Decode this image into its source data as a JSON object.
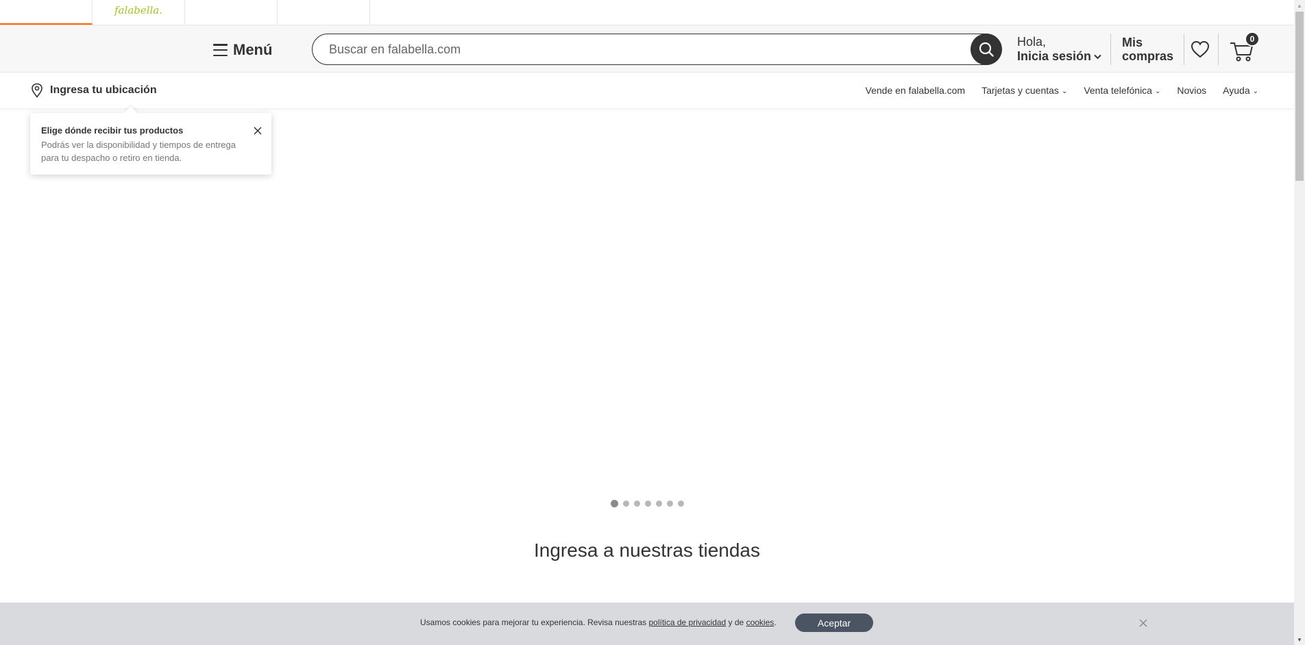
{
  "brand_tabs": [
    {
      "label": ""
    },
    {
      "label": "falabella."
    },
    {
      "label": ""
    },
    {
      "label": ""
    }
  ],
  "header": {
    "menu_label": "Menú",
    "search_placeholder": "Buscar en falabella.com",
    "login_line1": "Hola,",
    "login_line2": "Inicia sesión",
    "orders_line1": "Mis",
    "orders_line2": "compras",
    "cart_count": "0"
  },
  "subnav": {
    "location_label": "Ingresa tu ubicación",
    "links": [
      {
        "label": "Vende en falabella.com",
        "dropdown": false
      },
      {
        "label": "Tarjetas y cuentas",
        "dropdown": true
      },
      {
        "label": "Venta telefónica",
        "dropdown": true
      },
      {
        "label": "Novios",
        "dropdown": false
      },
      {
        "label": "Ayuda",
        "dropdown": true
      }
    ]
  },
  "tooltip": {
    "title": "Elige dónde recibir tus productos",
    "body": "Podrás ver la disponibilidad y tiempos de entrega para tu despacho o retiro en tienda."
  },
  "carousel": {
    "dot_count": 7,
    "active_index": 0
  },
  "section": {
    "title": "Ingresa a nuestras tiendas"
  },
  "cookie": {
    "text_before": "Usamos cookies para mejorar tu experiencia. Revisa nuestras ",
    "privacy_link": "política de privacidad",
    "text_middle": " y de ",
    "cookies_link": "cookies",
    "text_after": ".",
    "accept_label": "Aceptar"
  },
  "colors": {
    "brand_green": "#a3c51e",
    "accent_orange": "#ff6200",
    "dark": "#333333",
    "cookie_bg": "#d8dade",
    "cookie_button": "#4a5462"
  }
}
